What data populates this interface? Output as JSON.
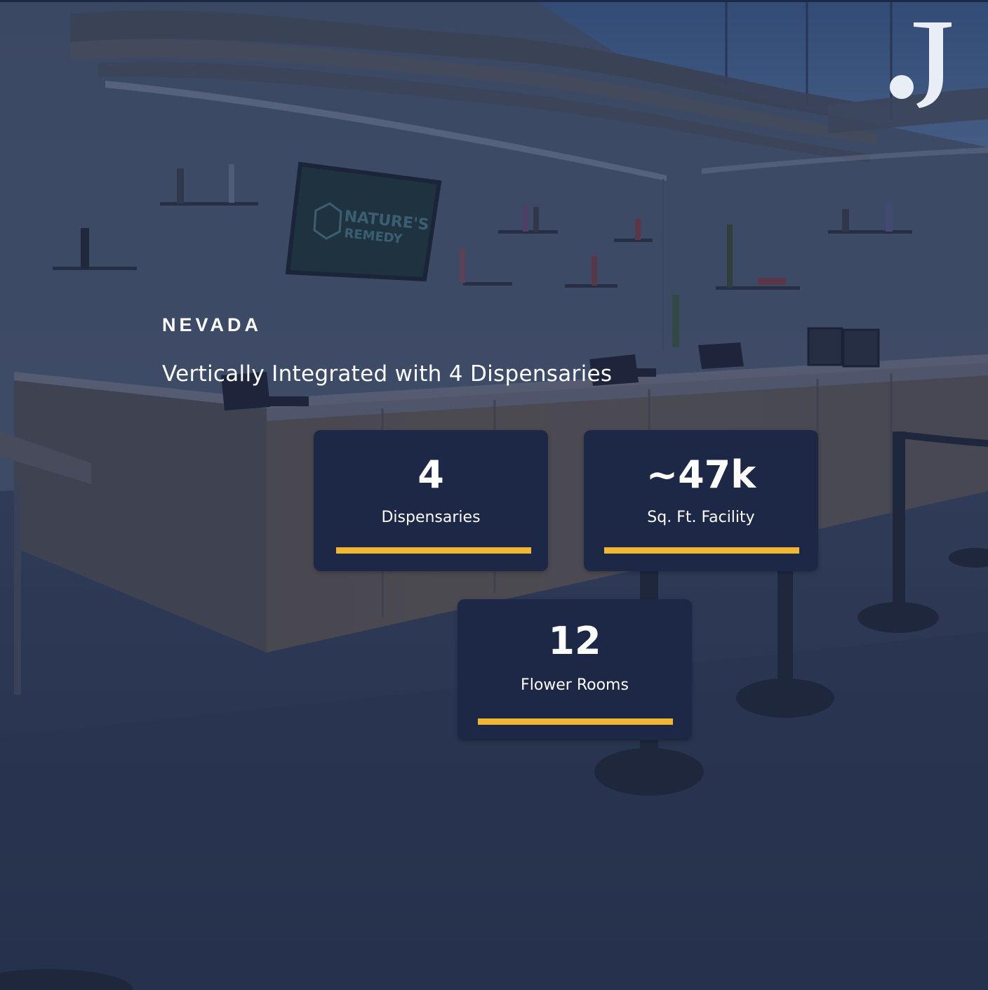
{
  "section_label": "NEVADA",
  "headline": "Vertically Integrated with 4 Dispensaries",
  "stats": [
    {
      "value": "4",
      "label": "Dispensaries"
    },
    {
      "value": "~47k",
      "label": "Sq. Ft. Facility"
    },
    {
      "value": "12",
      "label": "Flower Rooms"
    }
  ],
  "logo_letter": "J",
  "sign_text": {
    "line1": "NATURE'S",
    "line2": "REMEDY"
  },
  "colors": {
    "card_background": "#1c2845",
    "accent_bar": "#f2b732",
    "text": "#ffffff",
    "overlay": "#2b3a55"
  }
}
